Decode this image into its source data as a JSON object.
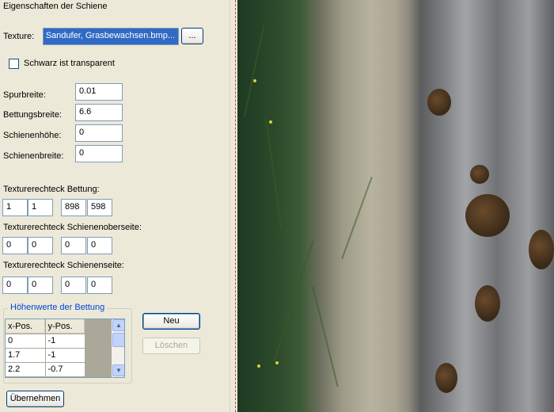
{
  "panel": {
    "title": "Eigenschaften der Schiene",
    "texture": {
      "label": "Texture:",
      "value": "...Braunsand, Sandufer, Grasbewachsen.bmp",
      "browse_label": "..."
    },
    "transparent": {
      "label": "Schwarz ist transparent",
      "checked": false
    },
    "fields": {
      "spurbreite": {
        "label": "Spurbreite:",
        "value": "0.01"
      },
      "bettungsbreite": {
        "label": "Bettungsbreite:",
        "value": "6.6"
      },
      "schienenhoehe": {
        "label": "Schienenhöhe:",
        "value": "0"
      },
      "schienenbreite": {
        "label": "Schienenbreite:",
        "value": "0"
      }
    },
    "rect_bettung": {
      "label": "Texturerechteck Bettung:",
      "values": [
        "1",
        "1",
        "898",
        "598"
      ]
    },
    "rect_oberseite": {
      "label": "Texturerechteck Schienenoberseite:",
      "values": [
        "0",
        "0",
        "0",
        "0"
      ]
    },
    "rect_seite": {
      "label": "Texturerechteck Schienenseite:",
      "values": [
        "0",
        "0",
        "0",
        "0"
      ]
    },
    "hoehenwerte": {
      "title": "Höhenwerte der Bettung",
      "columns": [
        "x-Pos.",
        "y-Pos."
      ],
      "rows": [
        [
          "0",
          "-1"
        ],
        [
          "1.7",
          "-1"
        ],
        [
          "2.2",
          "-0.7"
        ]
      ]
    },
    "buttons": {
      "neu": "Neu",
      "loeschen": "Löschen",
      "uebernehmen": "Übernehmen"
    }
  },
  "preview": {
    "description_icon": "texture-preview"
  }
}
